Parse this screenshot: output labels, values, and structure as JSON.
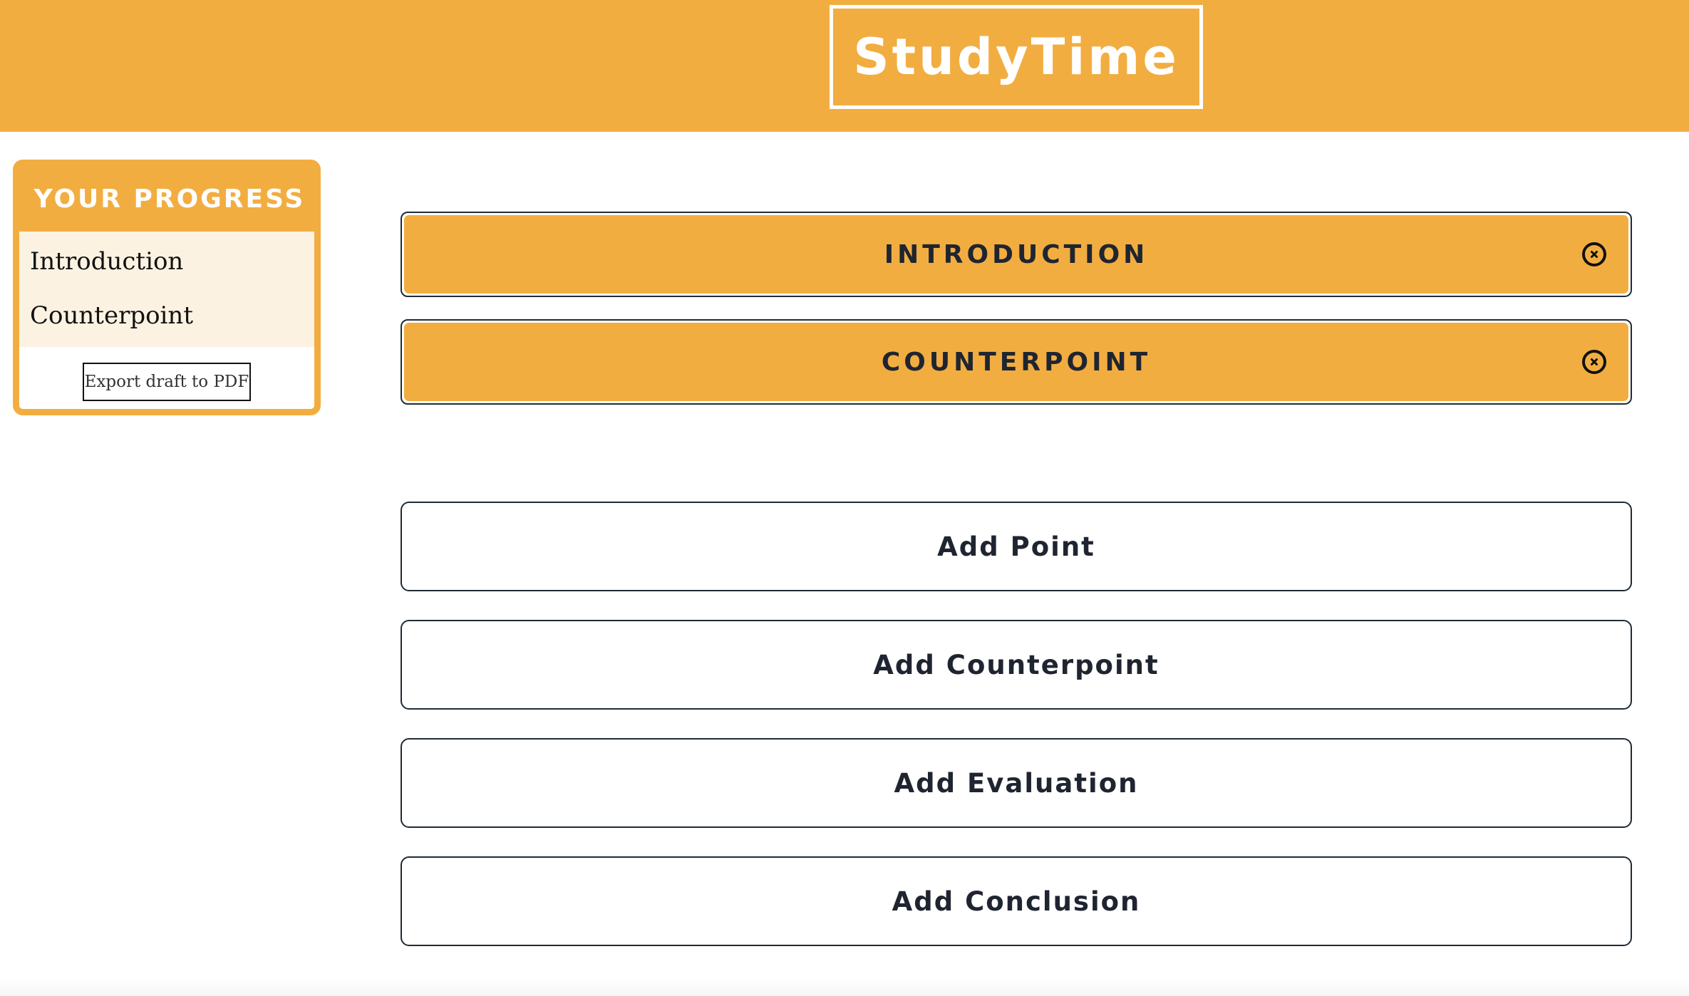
{
  "app": {
    "title": "StudyTime"
  },
  "progress": {
    "title": "YOUR PROGRESS",
    "items": [
      "Introduction",
      "Counterpoint"
    ],
    "export_label": "Export draft to PDF"
  },
  "sections": [
    {
      "title": "INTRODUCTION",
      "close_icon": "circle-x-icon"
    },
    {
      "title": "COUNTERPOINT",
      "close_icon": "circle-x-icon"
    }
  ],
  "add_buttons": [
    {
      "label": "Add Point"
    },
    {
      "label": "Add Counterpoint"
    },
    {
      "label": "Add Evaluation"
    },
    {
      "label": "Add Conclusion"
    }
  ],
  "colors": {
    "accent": "#f2ad41",
    "text_dark": "#1f2530",
    "panel_bg": "#fcf2e2"
  }
}
